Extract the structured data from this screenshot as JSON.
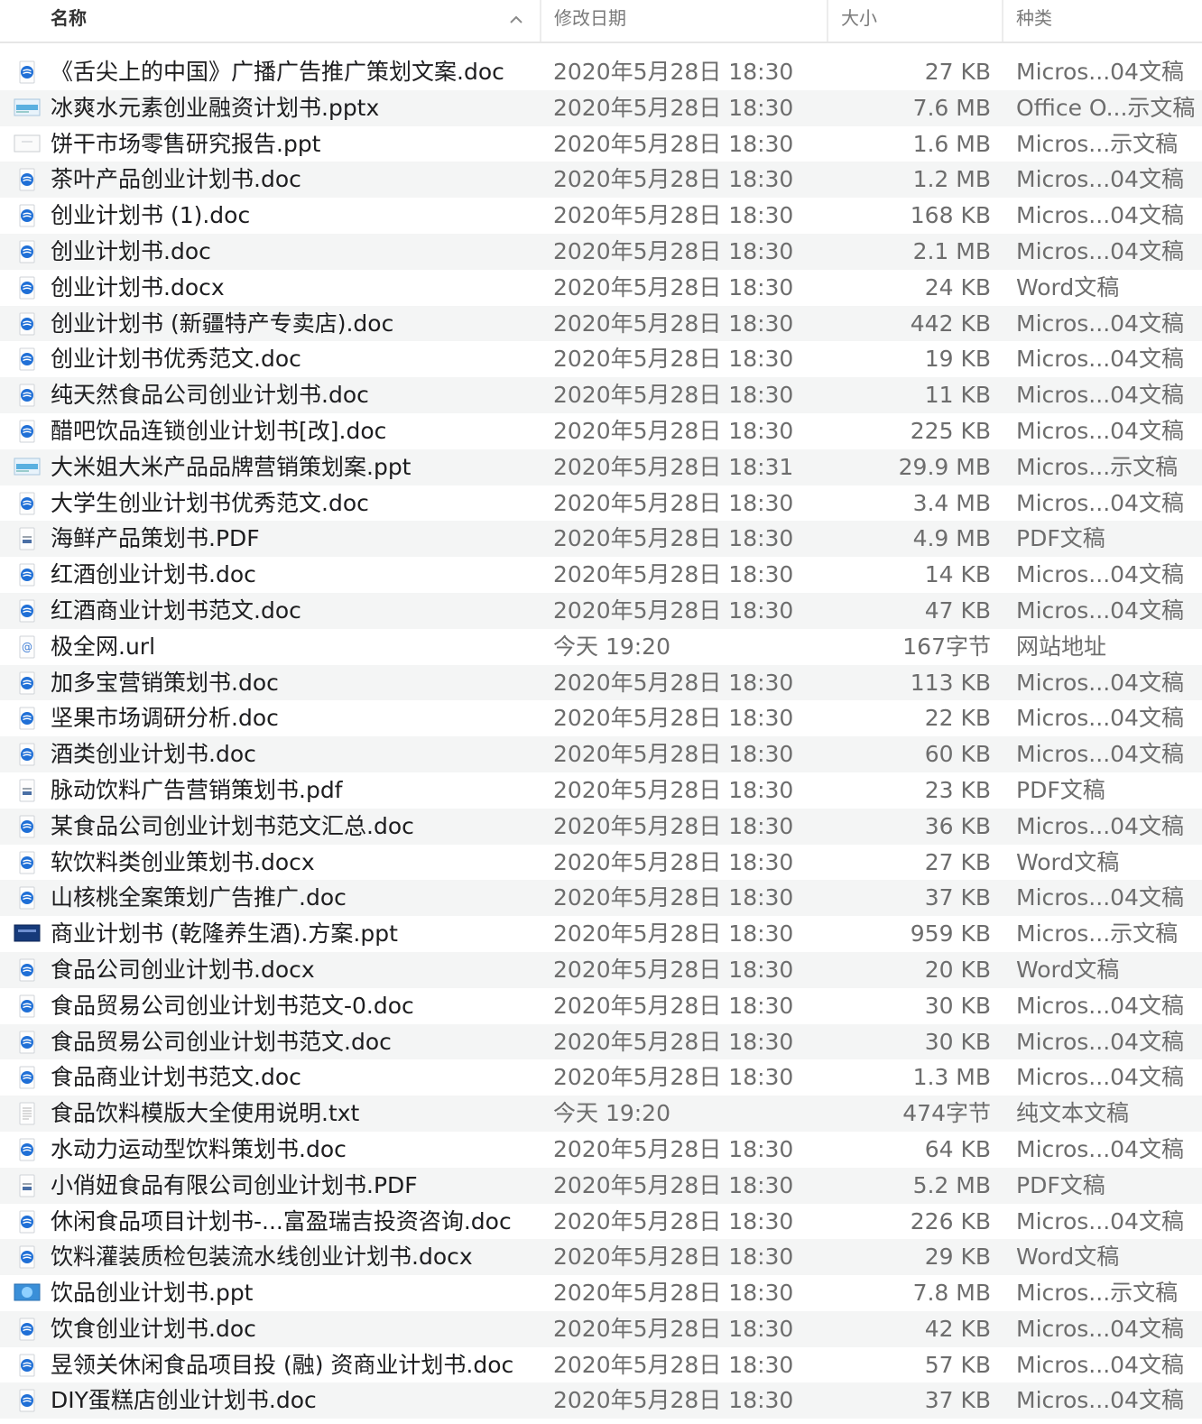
{
  "header": {
    "name": "名称",
    "date": "修改日期",
    "size": "大小",
    "kind": "种类"
  },
  "colors": {
    "accent_doc": "#1f6fd6",
    "alt_row": "#f4f5f5"
  },
  "files": [
    {
      "name": "《舌尖上的中国》广播广告推广策划文案.doc",
      "date": "2020年5月28日 18:30",
      "size": "27 KB",
      "kind": "Micros...04文稿",
      "icon": "word-doc-icon"
    },
    {
      "name": "冰爽水元素创业融资计划书.pptx",
      "date": "2020年5月28日 18:30",
      "size": "7.6 MB",
      "kind": "Office O...示文稿",
      "icon": "presentation-thumb-icon"
    },
    {
      "name": "饼干市场零售研究报告.ppt",
      "date": "2020年5月28日 18:30",
      "size": "1.6 MB",
      "kind": "Micros...示文稿",
      "icon": "blank-presentation-icon"
    },
    {
      "name": "茶叶产品创业计划书.doc",
      "date": "2020年5月28日 18:30",
      "size": "1.2 MB",
      "kind": "Micros...04文稿",
      "icon": "word-doc-icon"
    },
    {
      "name": "创业计划书 (1).doc",
      "date": "2020年5月28日 18:30",
      "size": "168 KB",
      "kind": "Micros...04文稿",
      "icon": "word-doc-icon"
    },
    {
      "name": "创业计划书.doc",
      "date": "2020年5月28日 18:30",
      "size": "2.1 MB",
      "kind": "Micros...04文稿",
      "icon": "word-doc-icon"
    },
    {
      "name": "创业计划书.docx",
      "date": "2020年5月28日 18:30",
      "size": "24 KB",
      "kind": "Word文稿",
      "icon": "word-doc-icon"
    },
    {
      "name": "创业计划书 (新疆特产专卖店).doc",
      "date": "2020年5月28日 18:30",
      "size": "442 KB",
      "kind": "Micros...04文稿",
      "icon": "word-doc-icon"
    },
    {
      "name": "创业计划书优秀范文.doc",
      "date": "2020年5月28日 18:30",
      "size": "19 KB",
      "kind": "Micros...04文稿",
      "icon": "word-doc-icon"
    },
    {
      "name": "纯天然食品公司创业计划书.doc",
      "date": "2020年5月28日 18:30",
      "size": "11 KB",
      "kind": "Micros...04文稿",
      "icon": "word-doc-icon"
    },
    {
      "name": "醋吧饮品连锁创业计划书[改].doc",
      "date": "2020年5月28日 18:30",
      "size": "225 KB",
      "kind": "Micros...04文稿",
      "icon": "word-doc-icon"
    },
    {
      "name": "大米姐大米产品品牌营销策划案.ppt",
      "date": "2020年5月28日 18:31",
      "size": "29.9 MB",
      "kind": "Micros...示文稿",
      "icon": "presentation-thumb-icon"
    },
    {
      "name": "大学生创业计划书优秀范文.doc",
      "date": "2020年5月28日 18:30",
      "size": "3.4 MB",
      "kind": "Micros...04文稿",
      "icon": "word-doc-icon"
    },
    {
      "name": "海鲜产品策划书.PDF",
      "date": "2020年5月28日 18:30",
      "size": "4.9 MB",
      "kind": "PDF文稿",
      "icon": "pdf-icon"
    },
    {
      "name": "红酒创业计划书.doc",
      "date": "2020年5月28日 18:30",
      "size": "14 KB",
      "kind": "Micros...04文稿",
      "icon": "word-doc-icon"
    },
    {
      "name": "红酒商业计划书范文.doc",
      "date": "2020年5月28日 18:30",
      "size": "47 KB",
      "kind": "Micros...04文稿",
      "icon": "word-doc-icon"
    },
    {
      "name": "极全网.url",
      "date": "今天 19:20",
      "size": "167字节",
      "kind": "网站地址",
      "icon": "url-icon"
    },
    {
      "name": "加多宝营销策划书.doc",
      "date": "2020年5月28日 18:30",
      "size": "113 KB",
      "kind": "Micros...04文稿",
      "icon": "word-doc-icon"
    },
    {
      "name": "坚果市场调研分析.doc",
      "date": "2020年5月28日 18:30",
      "size": "22 KB",
      "kind": "Micros...04文稿",
      "icon": "word-doc-icon"
    },
    {
      "name": "酒类创业计划书.doc",
      "date": "2020年5月28日 18:30",
      "size": "60 KB",
      "kind": "Micros...04文稿",
      "icon": "word-doc-icon"
    },
    {
      "name": "脉动饮料广告营销策划书.pdf",
      "date": "2020年5月28日 18:30",
      "size": "23 KB",
      "kind": "PDF文稿",
      "icon": "pdf-icon"
    },
    {
      "name": "某食品公司创业计划书范文汇总.doc",
      "date": "2020年5月28日 18:30",
      "size": "36 KB",
      "kind": "Micros...04文稿",
      "icon": "word-doc-icon"
    },
    {
      "name": "软饮料类创业策划书.docx",
      "date": "2020年5月28日 18:30",
      "size": "27 KB",
      "kind": "Word文稿",
      "icon": "word-doc-icon"
    },
    {
      "name": "山核桃全案策划广告推广.doc",
      "date": "2020年5月28日 18:30",
      "size": "37 KB",
      "kind": "Micros...04文稿",
      "icon": "word-doc-icon"
    },
    {
      "name": "商业计划书 (乾隆养生酒).方案.ppt",
      "date": "2020年5月28日 18:30",
      "size": "959 KB",
      "kind": "Micros...示文稿",
      "icon": "presentation-dark-icon"
    },
    {
      "name": "食品公司创业计划书.docx",
      "date": "2020年5月28日 18:30",
      "size": "20 KB",
      "kind": "Word文稿",
      "icon": "word-doc-icon"
    },
    {
      "name": "食品贸易公司创业计划书范文-0.doc",
      "date": "2020年5月28日 18:30",
      "size": "30 KB",
      "kind": "Micros...04文稿",
      "icon": "word-doc-icon"
    },
    {
      "name": "食品贸易公司创业计划书范文.doc",
      "date": "2020年5月28日 18:30",
      "size": "30 KB",
      "kind": "Micros...04文稿",
      "icon": "word-doc-icon"
    },
    {
      "name": "食品商业计划书范文.doc",
      "date": "2020年5月28日 18:30",
      "size": "1.3 MB",
      "kind": "Micros...04文稿",
      "icon": "word-doc-icon"
    },
    {
      "name": "食品饮料模版大全使用说明.txt",
      "date": "今天 19:20",
      "size": "474字节",
      "kind": "纯文本文稿",
      "icon": "text-file-icon"
    },
    {
      "name": "水动力运动型饮料策划书.doc",
      "date": "2020年5月28日 18:30",
      "size": "64 KB",
      "kind": "Micros...04文稿",
      "icon": "word-doc-icon"
    },
    {
      "name": "小俏妞食品有限公司创业计划书.PDF",
      "date": "2020年5月28日 18:30",
      "size": "5.2 MB",
      "kind": "PDF文稿",
      "icon": "pdf-icon"
    },
    {
      "name": "休闲食品项目计划书-...富盈瑞吉投资咨询.doc",
      "date": "2020年5月28日 18:30",
      "size": "226 KB",
      "kind": "Micros...04文稿",
      "icon": "word-doc-icon"
    },
    {
      "name": "饮料灌装质检包装流水线创业计划书.docx",
      "date": "2020年5月28日 18:30",
      "size": "29 KB",
      "kind": "Word文稿",
      "icon": "word-doc-icon"
    },
    {
      "name": "饮品创业计划书.ppt",
      "date": "2020年5月28日 18:30",
      "size": "7.8 MB",
      "kind": "Micros...示文稿",
      "icon": "presentation-blue-icon"
    },
    {
      "name": "饮食创业计划书.doc",
      "date": "2020年5月28日 18:30",
      "size": "42 KB",
      "kind": "Micros...04文稿",
      "icon": "word-doc-icon"
    },
    {
      "name": "昱领关休闲食品项目投 (融) 资商业计划书.doc",
      "date": "2020年5月28日 18:30",
      "size": "57 KB",
      "kind": "Micros...04文稿",
      "icon": "word-doc-icon"
    },
    {
      "name": "DIY蛋糕店创业计划书.doc",
      "date": "2020年5月28日 18:30",
      "size": "37 KB",
      "kind": "Micros...04文稿",
      "icon": "word-doc-icon"
    }
  ]
}
